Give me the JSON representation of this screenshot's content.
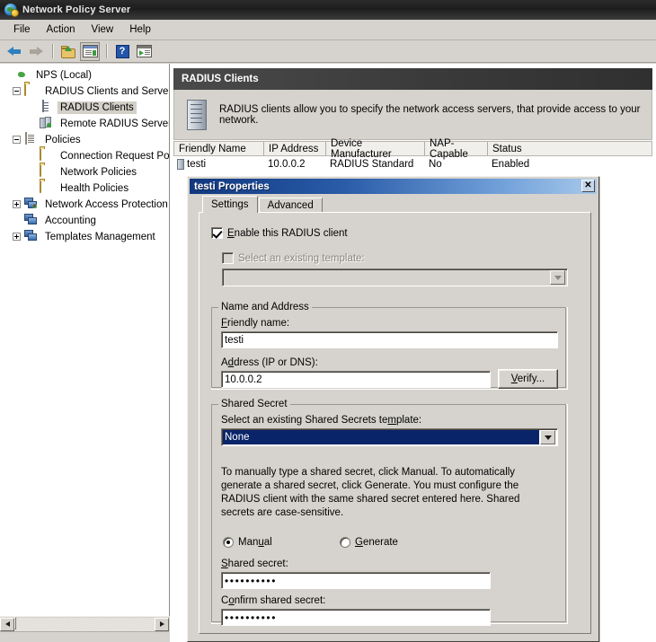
{
  "window": {
    "title": "Network Policy Server",
    "icon": "nps-globe-icon"
  },
  "menu": {
    "items": [
      "File",
      "Action",
      "View",
      "Help"
    ]
  },
  "toolbar": {
    "buttons": [
      {
        "name": "back-icon",
        "label": "Back"
      },
      {
        "name": "forward-icon",
        "label": "Forward"
      },
      {
        "name": "up-one-level-icon",
        "label": "Up One Level"
      },
      {
        "name": "show-hide-console-tree-icon",
        "label": "Show/Hide Console Tree"
      },
      {
        "name": "help-icon",
        "label": "Help"
      },
      {
        "name": "show-hide-action-pane-icon",
        "label": "Show/Hide Action Pane"
      }
    ]
  },
  "tree": {
    "nodes": [
      {
        "label": "NPS (Local)",
        "icon": "globe-icon",
        "expander": "none",
        "indent": 4,
        "selected": false
      },
      {
        "label": "RADIUS Clients and Servers",
        "icon": "folder-icon",
        "expander": "minus",
        "indent": 14,
        "selected": false
      },
      {
        "label": "RADIUS Clients",
        "icon": "server-icon",
        "expander": "none",
        "indent": 44,
        "selected": true
      },
      {
        "label": "Remote RADIUS Server G",
        "icon": "servers-icon",
        "expander": "none",
        "indent": 44,
        "selected": false
      },
      {
        "label": "Policies",
        "icon": "document-icon",
        "expander": "minus",
        "indent": 14,
        "selected": false
      },
      {
        "label": "Connection Request Polici",
        "icon": "folder-icon",
        "expander": "none",
        "indent": 44,
        "selected": false
      },
      {
        "label": "Network Policies",
        "icon": "folder-icon",
        "expander": "none",
        "indent": 44,
        "selected": false
      },
      {
        "label": "Health Policies",
        "icon": "folder-icon",
        "expander": "none",
        "indent": 44,
        "selected": false
      },
      {
        "label": "Network Access Protection",
        "icon": "monitor-check-icon",
        "expander": "plus",
        "indent": 14,
        "selected": false
      },
      {
        "label": "Accounting",
        "icon": "monitor-icon",
        "expander": "none",
        "indent": 14,
        "selected": false
      },
      {
        "label": "Templates Management",
        "icon": "monitor-icon",
        "expander": "plus",
        "indent": 14,
        "selected": false
      }
    ]
  },
  "content": {
    "header_title": "RADIUS Clients",
    "description": "RADIUS clients allow you to specify the network access servers, that provide access to your network.",
    "description_icon": "server-icon",
    "columns": [
      "Friendly Name",
      "IP Address",
      "Device Manufacturer",
      "NAP-Capable",
      "Status"
    ],
    "rows": [
      {
        "friendly_name": "testi",
        "ip_address": "10.0.0.2",
        "device_manufacturer": "RADIUS Standard",
        "nap_capable": "No",
        "status": "Enabled"
      }
    ]
  },
  "scrollbar": {
    "left_arrow": "scroll-left-icon",
    "right_arrow": "scroll-right-icon"
  },
  "dialog": {
    "title": "testi Properties",
    "close_label": "✕",
    "tabs": [
      {
        "label": "Settings",
        "active": true
      },
      {
        "label": "Advanced",
        "active": false
      }
    ],
    "enable_client": {
      "label": "Enable this RADIUS client",
      "checked": true
    },
    "select_template": {
      "label": "Select an existing template:",
      "checked": false,
      "enabled": false,
      "value": ""
    },
    "name_and_address": {
      "group_label": "Name and Address",
      "friendly_name_label": "Friendly name:",
      "friendly_name_value": "testi",
      "address_label": "Address (IP or DNS):",
      "address_value": "10.0.0.2",
      "verify_button": "Verify..."
    },
    "shared_secret": {
      "group_label": "Shared Secret",
      "template_label": "Select an existing Shared Secrets template:",
      "template_value": "None",
      "help_text": "To manually type a shared secret, click Manual. To automatically generate a shared secret, click Generate. You must configure the RADIUS client with the same shared secret entered here. Shared secrets are case-sensitive.",
      "manual_label": "Manual",
      "generate_label": "Generate",
      "mode": "Manual",
      "secret_label": "Shared secret:",
      "secret_value": "••••••••••",
      "confirm_label": "Confirm shared secret:",
      "confirm_value": "••••••••••"
    }
  },
  "colors": {
    "window_bg": "#d6d3ce",
    "titlebar": "#1d1d1d",
    "dialog_title_start": "#11387f",
    "dialog_title_end": "#a8c8ea",
    "selection_blue": "#0a246a",
    "content_header": "#3a3a3a"
  }
}
